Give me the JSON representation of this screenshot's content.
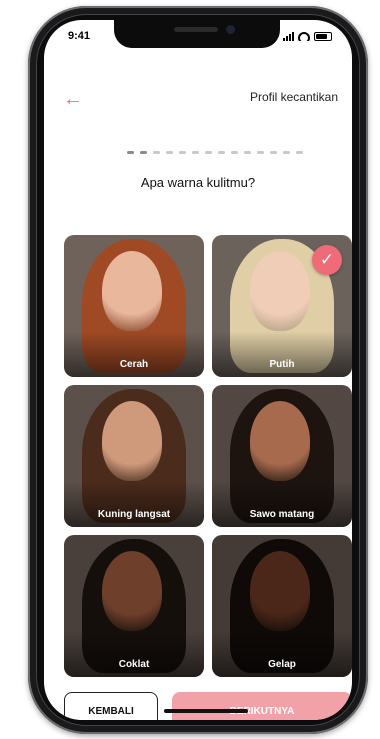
{
  "status_bar": {
    "time": "9:41"
  },
  "header": {
    "back_icon": "arrow-left-icon",
    "title": "Profil kecantikan"
  },
  "progress": {
    "total_steps": 14,
    "completed_steps": 2
  },
  "question": "Apa warna kulitmu?",
  "options": [
    {
      "label": "Cerah",
      "selected": false,
      "skin": "#e9b79c",
      "hair": "#a04a25",
      "bg": "#6f625a"
    },
    {
      "label": "Putih",
      "selected": true,
      "skin": "#f0cdb6",
      "hair": "#e0cfa6",
      "bg": "#6b625c"
    },
    {
      "label": "Kuning langsat",
      "selected": false,
      "skin": "#cf9a7c",
      "hair": "#4b2b1c",
      "bg": "#5c504a"
    },
    {
      "label": "Sawo matang",
      "selected": false,
      "skin": "#a86a4d",
      "hair": "#1d1410",
      "bg": "#524742"
    },
    {
      "label": "Coklat",
      "selected": false,
      "skin": "#6e3f2b",
      "hair": "#150f0c",
      "bg": "#4a403b"
    },
    {
      "label": "Gelap",
      "selected": false,
      "skin": "#4a2719",
      "hair": "#0f0a08",
      "bg": "#453b36"
    }
  ],
  "buttons": {
    "back_label": "KEMBALI",
    "next_label": "BERIKUTNYA"
  },
  "colors": {
    "accent": "#ee6b77"
  }
}
